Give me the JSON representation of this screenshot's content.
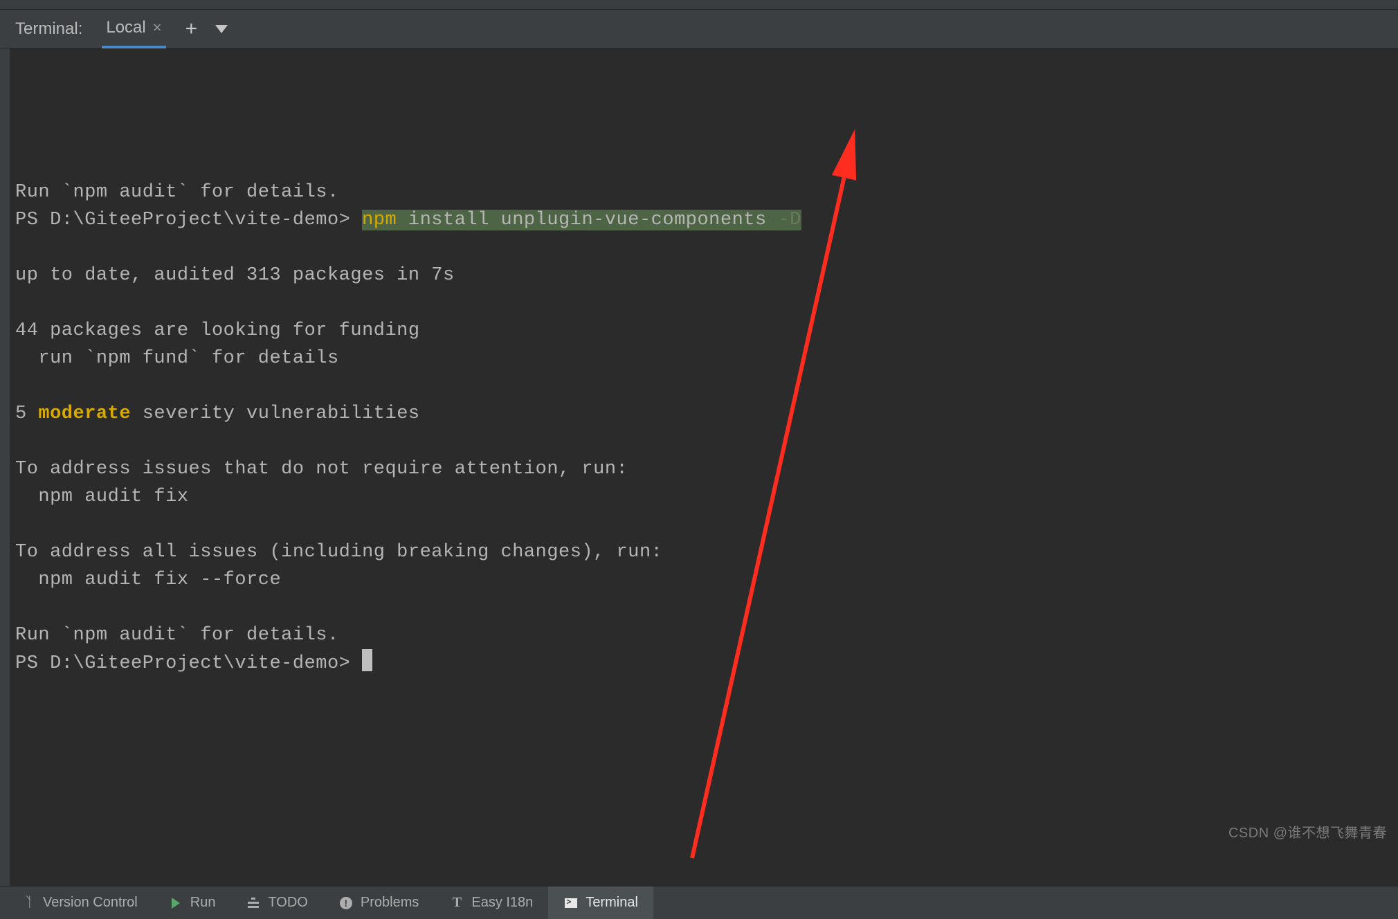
{
  "tabbar": {
    "title": "Terminal:",
    "active_tab": "Local",
    "plus": "+",
    "close_glyph": "×"
  },
  "terminal": {
    "l1": "Run `npm audit` for details.",
    "prompt1": "PS D:\\GiteeProject\\vite-demo> ",
    "cmd_npm": "npm",
    "cmd_rest": " install unplugin-vue-components ",
    "cmd_flag": "-D",
    "l3": "",
    "l4": "up to date, audited 313 packages in 7s",
    "l5": "",
    "l6": "44 packages are looking for funding",
    "l7": "  run `npm fund` for details",
    "l8": "",
    "l9_pre": "5 ",
    "l9_mod": "moderate",
    "l9_post": " severity vulnerabilities",
    "l10": "",
    "l11": "To address issues that do not require attention, run:",
    "l12": "  npm audit fix",
    "l13": "",
    "l14": "To address all issues (including breaking changes), run:",
    "l15": "  npm audit fix --force",
    "l16": "",
    "l17": "Run `npm audit` for details.",
    "prompt2": "PS D:\\GiteeProject\\vite-demo> "
  },
  "bottombar": {
    "vcs": "Version Control",
    "run": "Run",
    "todo": "TODO",
    "problems": "Problems",
    "i18n": "Easy I18n",
    "terminal": "Terminal"
  },
  "watermark": "CSDN @谁不想飞舞青春"
}
